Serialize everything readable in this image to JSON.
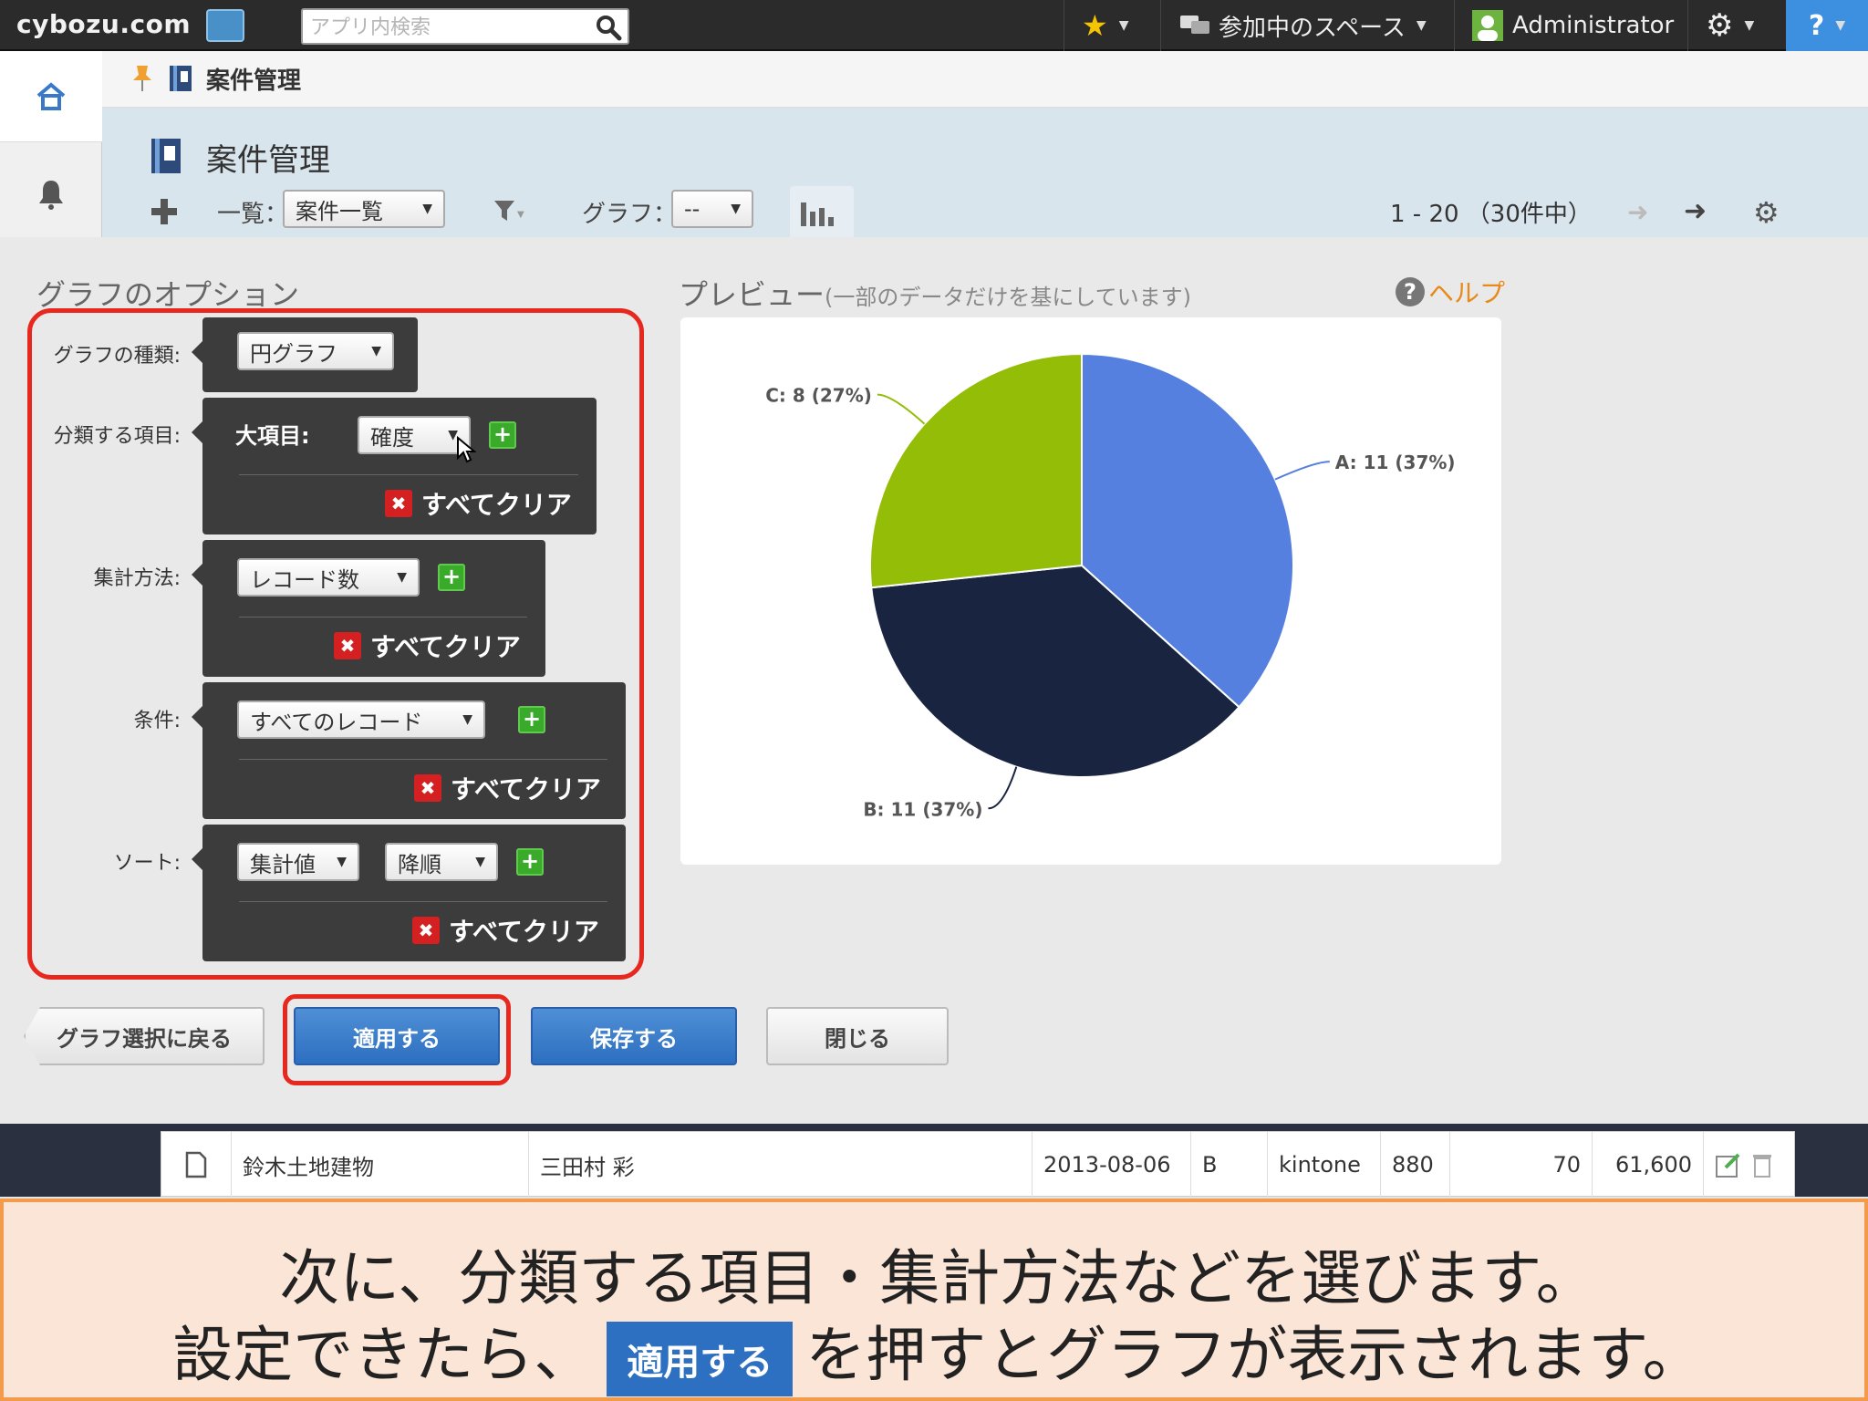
{
  "header": {
    "logo": "cybozu.com",
    "search_placeholder": "アプリ内検索",
    "spaces_label": "参加中のスペース",
    "user_name": "Administrator",
    "help_label": "?"
  },
  "breadcrumb": {
    "app_name": "案件管理"
  },
  "app": {
    "title": "案件管理",
    "view_label": "一覧：",
    "view_value": "案件一覧",
    "graph_label": "グラフ：",
    "graph_value": "--",
    "pager_text": "1 - 20 （30件中）"
  },
  "options": {
    "title": "グラフのオプション",
    "type_label": "グラフの種類:",
    "type_value": "円グラフ",
    "group_label": "分類する項目:",
    "group_sub_label": "大項目:",
    "group_value": "確度",
    "agg_label": "集計方法:",
    "agg_value": "レコード数",
    "cond_label": "条件:",
    "cond_value": "すべてのレコード",
    "sort_label": "ソート:",
    "sort_value": "集計値",
    "sort_order": "降順",
    "clear_label": "すべてクリア"
  },
  "preview": {
    "title": "プレビュー",
    "note": "(一部のデータだけを基にしています)",
    "help": "ヘルプ"
  },
  "chart_data": {
    "type": "pie",
    "title": "",
    "slices": [
      {
        "category": "A",
        "value": 11,
        "percent": 37,
        "label": "A: 11 (37%)",
        "color": "#5580e0"
      },
      {
        "category": "B",
        "value": 11,
        "percent": 37,
        "label": "B: 11 (37%)",
        "color": "#192440"
      },
      {
        "category": "C",
        "value": 8,
        "percent": 27,
        "label": "C: 8 (27%)",
        "color": "#93bd07"
      }
    ]
  },
  "buttons": {
    "back": "グラフ選択に戻る",
    "apply": "適用する",
    "save": "保存する",
    "close": "閉じる"
  },
  "record_row": {
    "company": "鈴木土地建物",
    "person": "三田村 彩",
    "date": "2013-08-06",
    "rank": "B",
    "product": "kintone",
    "unit_price": "880",
    "quantity": "70",
    "subtotal": "61,600"
  },
  "caption": {
    "line1": "次に、分類する項目・集計方法などを選びます。",
    "line2_pre": "設定できたら、",
    "line2_button": "適用する",
    "line2_post": "を押すとグラフが表示されます。"
  },
  "colors": {
    "accent_red": "#e8281e",
    "button_blue": "#2d6fc0",
    "caption_bg": "#fbe5d6",
    "caption_border": "#f29b4a"
  }
}
